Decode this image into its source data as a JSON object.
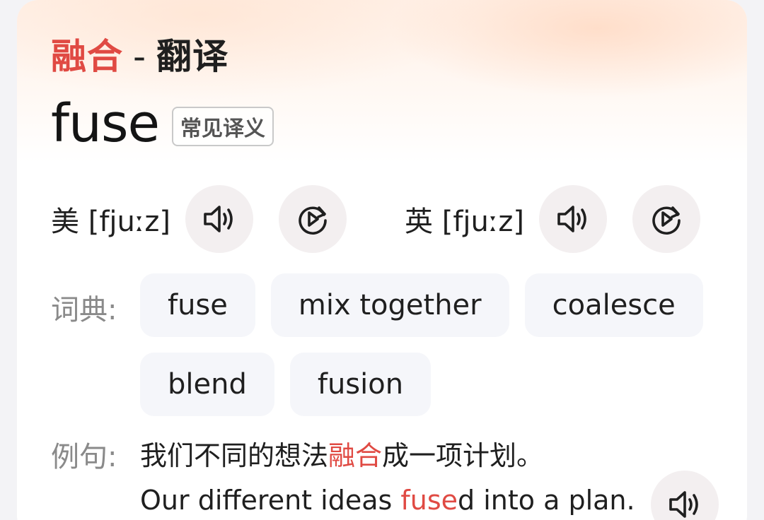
{
  "header": {
    "keyword": "融合",
    "separator": "-",
    "title_rest": "翻译"
  },
  "headword": {
    "word": "fuse",
    "tag": "常见译义"
  },
  "pronunciation": {
    "us": {
      "label": "美 [fjuːz]"
    },
    "uk": {
      "label": "英 [fjuːz]"
    }
  },
  "dictionary": {
    "label": "词典:",
    "items": [
      "fuse",
      "mix together",
      "coalesce",
      "blend",
      "fusion"
    ]
  },
  "example": {
    "label": "例句:",
    "cn_pre": "我们不同的想法",
    "cn_hl": "融合",
    "cn_post": "成一项计划。",
    "en_pre": "Our different ideas ",
    "en_hl": "fuse",
    "en_post": "d into a plan."
  },
  "icons": {
    "speaker": "speaker-icon",
    "replay": "replay-icon"
  },
  "colors": {
    "accent": "#e04a43",
    "chip_bg": "#f5f6fa",
    "button_bg": "#f3eff0"
  }
}
